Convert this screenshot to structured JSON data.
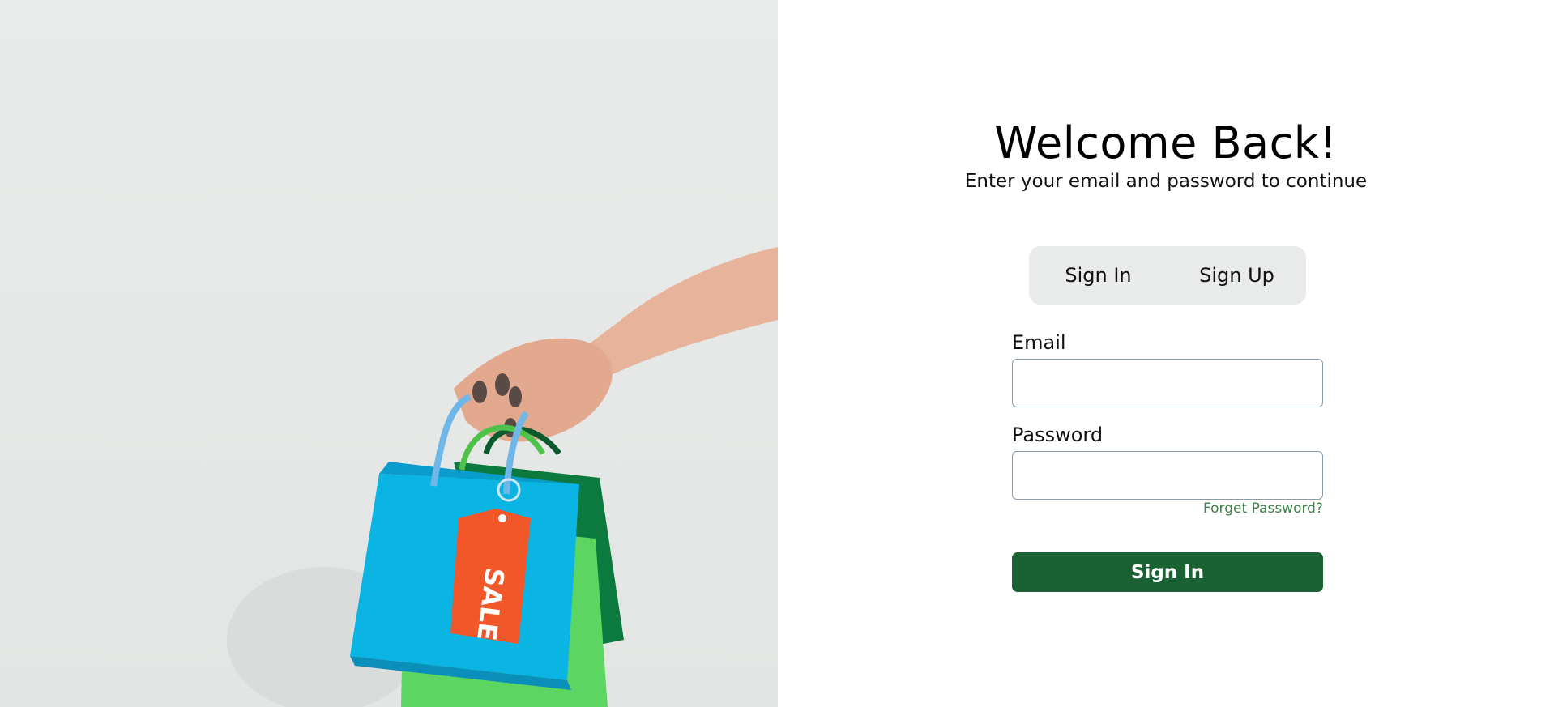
{
  "hero": {
    "tag_text": "SALE"
  },
  "header": {
    "title": "Welcome Back!",
    "subtitle": "Enter your email and password to continue"
  },
  "tabs": [
    {
      "label": "Sign In"
    },
    {
      "label": "Sign Up"
    }
  ],
  "form": {
    "email_label": "Email",
    "email_value": "",
    "password_label": "Password",
    "password_value": "",
    "forgot_label": "Forget Password?",
    "submit_label": "Sign In"
  },
  "colors": {
    "primary_button": "#1a6233",
    "forgot_link": "#3f7f4a",
    "tab_background": "#e9eaea",
    "hero_background": "#e8eae9"
  }
}
